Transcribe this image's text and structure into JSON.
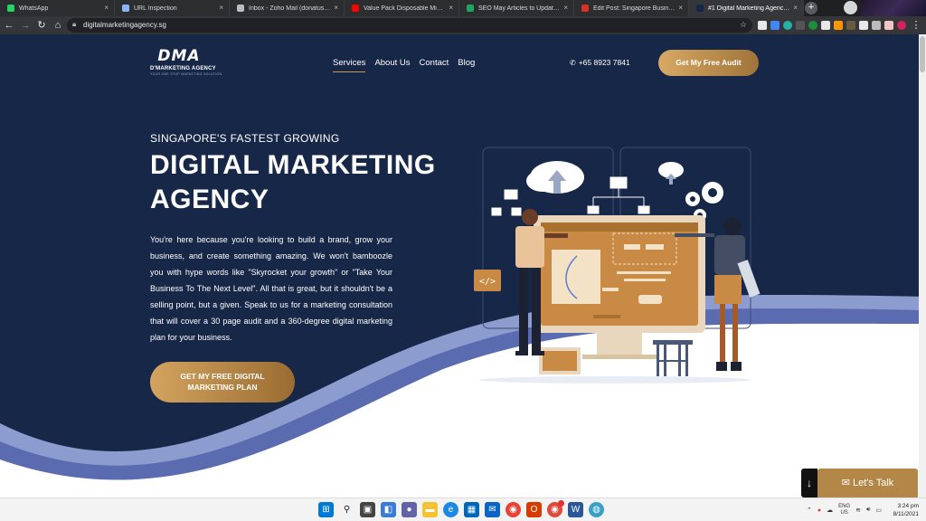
{
  "browser": {
    "tabs": [
      {
        "title": "WhatsApp",
        "color": "#25d366",
        "active": false
      },
      {
        "title": "URL Inspection",
        "color": "#8ab4f8",
        "active": false
      },
      {
        "title": "Inbox - Zoho Mail (donatus@t…",
        "color": "#bdbdbd",
        "active": false
      },
      {
        "title": "Value Pack Disposable Mi…",
        "color": "#ff0000",
        "active": false
      },
      {
        "title": "SEO May Articles to Update - G…",
        "color": "#1fa463",
        "active": false
      },
      {
        "title": "Edit Post: Singapore Business…",
        "color": "#d93025",
        "active": false
      },
      {
        "title": "#1 Digital Marketing Agency | S…",
        "color": "#172747",
        "active": true
      }
    ],
    "new_tab_glyph": "+",
    "url": "digitalmarketingagency.sg"
  },
  "site": {
    "logo_mark": "DMA",
    "logo_name": "D'MARKETING AGENCY",
    "logo_tagline": "YOUR ONE STOP MARKETING SOLUTION",
    "nav": [
      "Services",
      "About Us",
      "Contact",
      "Blog"
    ],
    "phone": "+65 8923 7841",
    "audit_button": "Get My Free Audit",
    "eyebrow": "SINGAPORE'S FASTEST GROWING",
    "headline": "DIGITAL MARKETING AGENCY",
    "body": "You're here because you're looking to build a brand, grow your business, and create something amazing. We won't bamboozle you with hype words like \"Skyrocket your growth\" or \"Take Your Business To The Next Level\". All that is great, but it shouldn't be a selling point, but a given. Speak to us for a marketing consultation that will cover a 30 page audit and a 360-degree digital marketing plan for your business.",
    "cta_line1": "GET MY FREE DIGITAL",
    "cta_line2": "MARKETING PLAN",
    "lets_talk": "✉ Let's Talk",
    "arrow": "↓",
    "illustration_code_tag": "</>"
  },
  "colors": {
    "hero_bg": "#172747",
    "gold": "#c99a54",
    "wave_light": "#8d9ccf",
    "wave_mid": "#5b6bb0"
  },
  "taskbar": {
    "lang_line1": "ENG",
    "lang_line2": "US",
    "time": "3:24 pm",
    "date": "8/11/2021"
  }
}
